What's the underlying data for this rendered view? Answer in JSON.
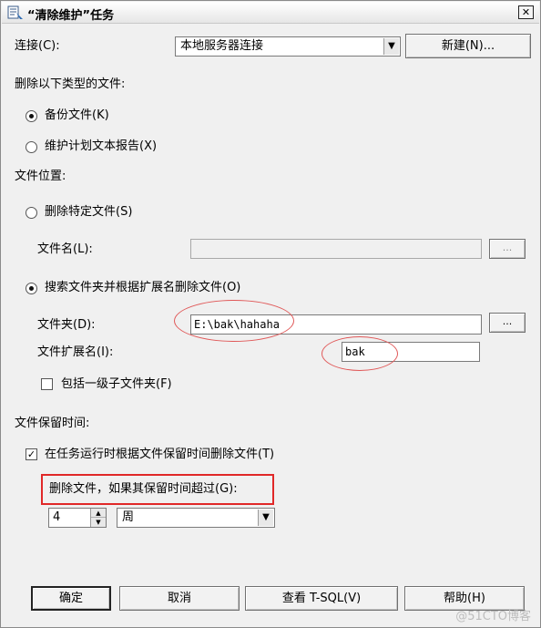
{
  "window": {
    "title": "“清除维护”任务",
    "close_label": "✕"
  },
  "connection": {
    "label": "连接(C):",
    "selected": "本地服务器连接",
    "new_button": "新建(N)..."
  },
  "delete_type": {
    "heading": "删除以下类型的文件:",
    "options": [
      {
        "label": "备份文件(K)",
        "checked": true
      },
      {
        "label": "维护计划文本报告(X)",
        "checked": false
      }
    ]
  },
  "file_location": {
    "heading": "文件位置:",
    "specific": {
      "label": "删除特定文件(S)",
      "checked": false,
      "filename_label": "文件名(L):",
      "filename_value": "",
      "browse_label": "..."
    },
    "search": {
      "label": "搜索文件夹并根据扩展名删除文件(O)",
      "checked": true,
      "folder_label": "文件夹(D):",
      "folder_value": "E:\\bak\\hahaha",
      "browse_label": "...",
      "ext_label": "文件扩展名(I):",
      "ext_value": "bak",
      "subfolder_label": "包括一级子文件夹(F)",
      "subfolder_checked": false
    }
  },
  "retention": {
    "heading": "文件保留时间:",
    "enable_label": "在任务运行时根据文件保留时间删除文件(T)",
    "enable_checked": true,
    "older_than_label": "删除文件，如果其保留时间超过(G):",
    "amount": "4",
    "unit": "周"
  },
  "footer": {
    "ok": "确定",
    "cancel": "取消",
    "view_tsql": "查看 T-SQL(V)",
    "help": "帮助(H)"
  },
  "watermark": "@51CTO博客",
  "colors": {
    "annotation_red": "#e02828",
    "annotation_ellipse": "#e05858"
  }
}
